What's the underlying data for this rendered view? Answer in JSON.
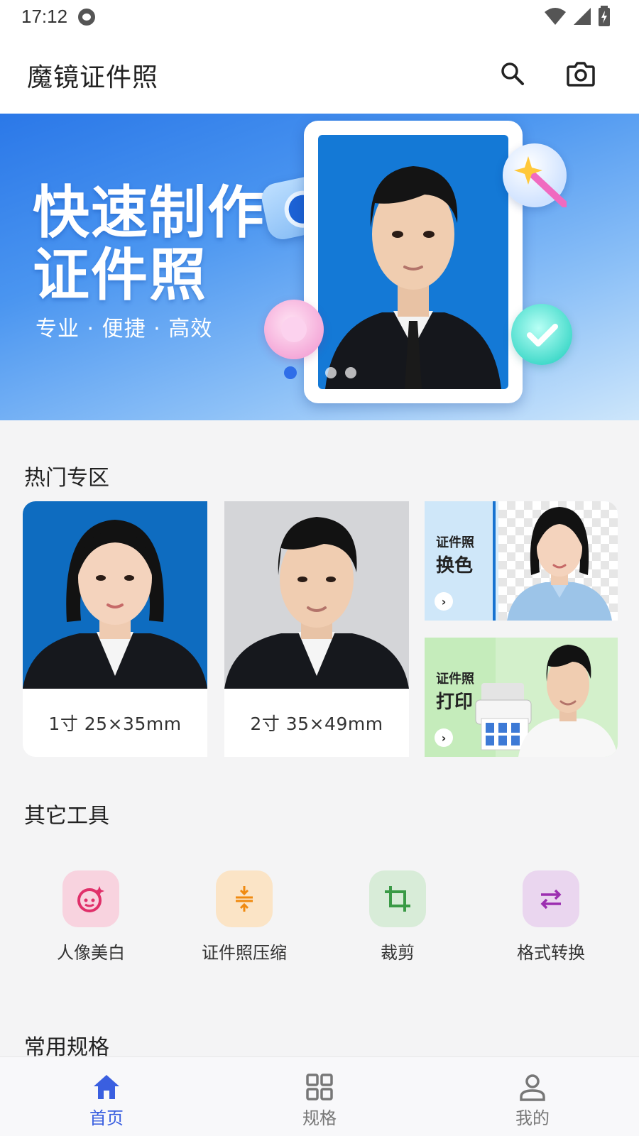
{
  "status_bar": {
    "time": "17:12"
  },
  "app_bar": {
    "title": "魔镜证件照",
    "search_icon": "search-icon",
    "camera_icon": "camera-icon"
  },
  "banner": {
    "title": "快速制作证件照",
    "subtitle": "专业 · 便捷 · 高效",
    "page_count": 4,
    "active_page": 1
  },
  "hot_section": {
    "title": "热门专区",
    "cards": [
      {
        "label": "1寸  25×35mm"
      },
      {
        "label": "2寸  35×49mm"
      }
    ],
    "side_cards": [
      {
        "top_label": "证件照",
        "main_label": "换色"
      },
      {
        "top_label": "证件照",
        "main_label": "打印"
      }
    ]
  },
  "tools_section": {
    "title": "其它工具",
    "tools": [
      {
        "label": "人像美白",
        "icon": "face-sparkle-icon",
        "bg": "#f8d3df",
        "color": "#e0306a"
      },
      {
        "label": "证件照压缩",
        "icon": "compress-icon",
        "bg": "#fbe4c6",
        "color": "#f08a10"
      },
      {
        "label": "裁剪",
        "icon": "crop-icon",
        "bg": "#d8ecd8",
        "color": "#3a9a46"
      },
      {
        "label": "格式转换",
        "icon": "swap-icon",
        "bg": "#ead6ef",
        "color": "#9c2fb0"
      }
    ]
  },
  "common_section": {
    "title": "常用规格"
  },
  "bottom_nav": {
    "items": [
      {
        "label": "首页",
        "icon": "home-icon",
        "active": true
      },
      {
        "label": "规格",
        "icon": "grid-icon",
        "active": false
      },
      {
        "label": "我的",
        "icon": "person-icon",
        "active": false
      }
    ]
  },
  "colors": {
    "accent": "#3a5fe0",
    "banner_blue": "#2b78e8"
  }
}
